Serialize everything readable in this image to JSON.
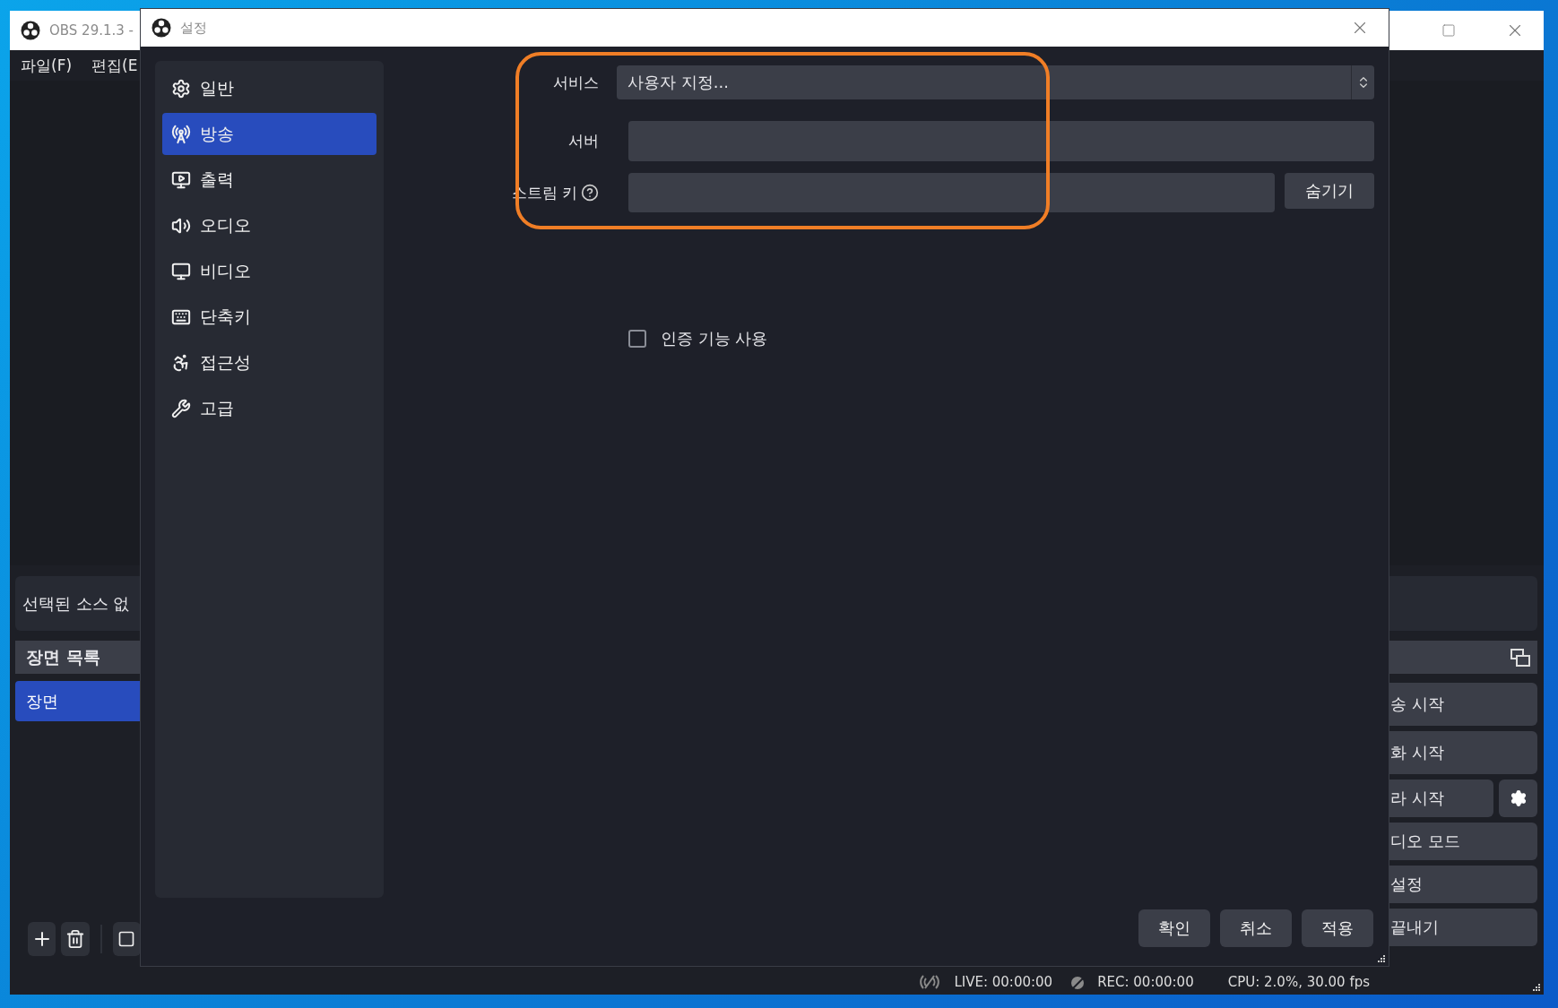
{
  "main_window": {
    "title": "OBS 29.1.3 -",
    "menu": [
      "파일(F)",
      "편집(E"
    ]
  },
  "sources_panel": {
    "empty_text": "선택된 소스 없"
  },
  "scenes_dock": {
    "title": "장면 목록",
    "items": [
      {
        "label": "장면",
        "selected": true
      }
    ]
  },
  "controls_dock": {
    "buttons": [
      {
        "label": "송 시작",
        "kind": "wide"
      },
      {
        "label": "화 시작",
        "kind": "wide"
      },
      {
        "label": "라 시작",
        "kind": "split"
      },
      {
        "label": "디오 모드",
        "kind": "wide"
      },
      {
        "label": "설정",
        "kind": "wide"
      },
      {
        "label": "끝내기",
        "kind": "wide"
      }
    ]
  },
  "status_bar": {
    "live": "LIVE: 00:00:00",
    "rec": "REC: 00:00:00",
    "cpu": "CPU: 2.0%, 30.00 fps"
  },
  "settings_dialog": {
    "title": "설정",
    "sidebar": [
      {
        "label": "일반",
        "selected": false
      },
      {
        "label": "방송",
        "selected": true
      },
      {
        "label": "출력",
        "selected": false
      },
      {
        "label": "오디오",
        "selected": false
      },
      {
        "label": "비디오",
        "selected": false
      },
      {
        "label": "단축키",
        "selected": false
      },
      {
        "label": "접근성",
        "selected": false
      },
      {
        "label": "고급",
        "selected": false
      }
    ],
    "form": {
      "service_label": "서비스",
      "service_value": "사용자 지정...",
      "server_label": "서버",
      "stream_key_label": "스트림 키",
      "hide_button": "숨기기"
    },
    "auth_checkbox": {
      "label": "인증 기능 사용",
      "checked": false
    },
    "buttons": [
      "확인",
      "취소",
      "적용"
    ]
  }
}
